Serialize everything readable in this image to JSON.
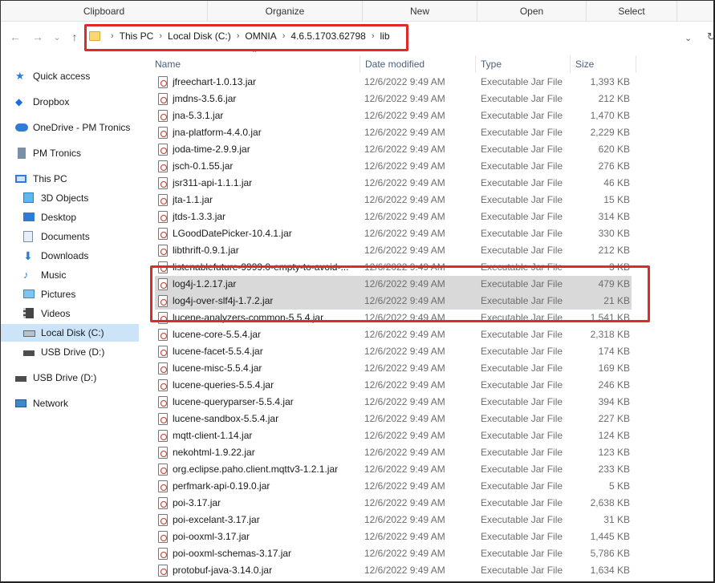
{
  "ribbon": [
    {
      "label": "Clipboard"
    },
    {
      "label": "Organize"
    },
    {
      "label": "New"
    },
    {
      "label": "Open"
    },
    {
      "label": "Select"
    }
  ],
  "address": {
    "crumbs": [
      "This PC",
      "Local Disk (C:)",
      "OMNIA",
      "4.6.5.1703.62798",
      "lib"
    ]
  },
  "icons": {
    "back": "←",
    "forward": "→",
    "recent": "⌄",
    "up": "↑",
    "crumb_sep": "›",
    "addr_dropdown": "⌄",
    "refresh": "↻",
    "sort": "⌃"
  },
  "sidebar": {
    "items": [
      {
        "label": "Quick access",
        "icon": "star-icon"
      },
      {
        "label": "Dropbox",
        "icon": "dropbox-icon"
      },
      {
        "label": "OneDrive - PM Tronics",
        "icon": "cloud-icon"
      },
      {
        "label": "PM Tronics",
        "icon": "building-icon"
      },
      {
        "label": "This PC",
        "icon": "computer-icon"
      },
      {
        "label": "3D Objects",
        "icon": "cube-icon"
      },
      {
        "label": "Desktop",
        "icon": "desktop-icon"
      },
      {
        "label": "Documents",
        "icon": "document-icon"
      },
      {
        "label": "Downloads",
        "icon": "download-icon"
      },
      {
        "label": "Music",
        "icon": "music-icon"
      },
      {
        "label": "Pictures",
        "icon": "pictures-icon"
      },
      {
        "label": "Videos",
        "icon": "video-icon"
      },
      {
        "label": "Local Disk (C:)",
        "icon": "disk-icon",
        "selected": true
      },
      {
        "label": "USB Drive (D:)",
        "icon": "usb-icon"
      },
      {
        "label": "USB Drive (D:)",
        "icon": "usb-icon"
      },
      {
        "label": "Network",
        "icon": "network-icon"
      }
    ]
  },
  "columns": {
    "name": "Name",
    "date": "Date modified",
    "type": "Type",
    "size": "Size"
  },
  "files": [
    {
      "name": "jfreechart-1.0.13.jar",
      "date": "12/6/2022 9:49 AM",
      "type": "Executable Jar File",
      "size": "1,393 KB"
    },
    {
      "name": "jmdns-3.5.6.jar",
      "date": "12/6/2022 9:49 AM",
      "type": "Executable Jar File",
      "size": "212 KB"
    },
    {
      "name": "jna-5.3.1.jar",
      "date": "12/6/2022 9:49 AM",
      "type": "Executable Jar File",
      "size": "1,470 KB"
    },
    {
      "name": "jna-platform-4.4.0.jar",
      "date": "12/6/2022 9:49 AM",
      "type": "Executable Jar File",
      "size": "2,229 KB"
    },
    {
      "name": "joda-time-2.9.9.jar",
      "date": "12/6/2022 9:49 AM",
      "type": "Executable Jar File",
      "size": "620 KB"
    },
    {
      "name": "jsch-0.1.55.jar",
      "date": "12/6/2022 9:49 AM",
      "type": "Executable Jar File",
      "size": "276 KB"
    },
    {
      "name": "jsr311-api-1.1.1.jar",
      "date": "12/6/2022 9:49 AM",
      "type": "Executable Jar File",
      "size": "46 KB"
    },
    {
      "name": "jta-1.1.jar",
      "date": "12/6/2022 9:49 AM",
      "type": "Executable Jar File",
      "size": "15 KB"
    },
    {
      "name": "jtds-1.3.3.jar",
      "date": "12/6/2022 9:49 AM",
      "type": "Executable Jar File",
      "size": "314 KB"
    },
    {
      "name": "LGoodDatePicker-10.4.1.jar",
      "date": "12/6/2022 9:49 AM",
      "type": "Executable Jar File",
      "size": "330 KB"
    },
    {
      "name": "libthrift-0.9.1.jar",
      "date": "12/6/2022 9:49 AM",
      "type": "Executable Jar File",
      "size": "212 KB"
    },
    {
      "name": "listenablefuture-9999.0-empty-to-avoid-...",
      "date": "12/6/2022 9:49 AM",
      "type": "Executable Jar File",
      "size": "3 KB"
    },
    {
      "name": "log4j-1.2.17.jar",
      "date": "12/6/2022 9:49 AM",
      "type": "Executable Jar File",
      "size": "479 KB",
      "selected": true
    },
    {
      "name": "log4j-over-slf4j-1.7.2.jar",
      "date": "12/6/2022 9:49 AM",
      "type": "Executable Jar File",
      "size": "21 KB",
      "selected": true
    },
    {
      "name": "lucene-analyzers-common-5.5.4.jar",
      "date": "12/6/2022 9:49 AM",
      "type": "Executable Jar File",
      "size": "1,541 KB"
    },
    {
      "name": "lucene-core-5.5.4.jar",
      "date": "12/6/2022 9:49 AM",
      "type": "Executable Jar File",
      "size": "2,318 KB"
    },
    {
      "name": "lucene-facet-5.5.4.jar",
      "date": "12/6/2022 9:49 AM",
      "type": "Executable Jar File",
      "size": "174 KB"
    },
    {
      "name": "lucene-misc-5.5.4.jar",
      "date": "12/6/2022 9:49 AM",
      "type": "Executable Jar File",
      "size": "169 KB"
    },
    {
      "name": "lucene-queries-5.5.4.jar",
      "date": "12/6/2022 9:49 AM",
      "type": "Executable Jar File",
      "size": "246 KB"
    },
    {
      "name": "lucene-queryparser-5.5.4.jar",
      "date": "12/6/2022 9:49 AM",
      "type": "Executable Jar File",
      "size": "394 KB"
    },
    {
      "name": "lucene-sandbox-5.5.4.jar",
      "date": "12/6/2022 9:49 AM",
      "type": "Executable Jar File",
      "size": "227 KB"
    },
    {
      "name": "mqtt-client-1.14.jar",
      "date": "12/6/2022 9:49 AM",
      "type": "Executable Jar File",
      "size": "124 KB"
    },
    {
      "name": "nekohtml-1.9.22.jar",
      "date": "12/6/2022 9:49 AM",
      "type": "Executable Jar File",
      "size": "123 KB"
    },
    {
      "name": "org.eclipse.paho.client.mqttv3-1.2.1.jar",
      "date": "12/6/2022 9:49 AM",
      "type": "Executable Jar File",
      "size": "233 KB"
    },
    {
      "name": "perfmark-api-0.19.0.jar",
      "date": "12/6/2022 9:49 AM",
      "type": "Executable Jar File",
      "size": "5 KB"
    },
    {
      "name": "poi-3.17.jar",
      "date": "12/6/2022 9:49 AM",
      "type": "Executable Jar File",
      "size": "2,638 KB"
    },
    {
      "name": "poi-excelant-3.17.jar",
      "date": "12/6/2022 9:49 AM",
      "type": "Executable Jar File",
      "size": "31 KB"
    },
    {
      "name": "poi-ooxml-3.17.jar",
      "date": "12/6/2022 9:49 AM",
      "type": "Executable Jar File",
      "size": "1,445 KB"
    },
    {
      "name": "poi-ooxml-schemas-3.17.jar",
      "date": "12/6/2022 9:49 AM",
      "type": "Executable Jar File",
      "size": "5,786 KB"
    },
    {
      "name": "protobuf-java-3.14.0.jar",
      "date": "12/6/2022 9:49 AM",
      "type": "Executable Jar File",
      "size": "1,634 KB"
    }
  ],
  "colors": {
    "highlight_box": "#e02a2a",
    "selected_row": "#d9d9d9",
    "sidebar_selected": "#cce4f7"
  }
}
